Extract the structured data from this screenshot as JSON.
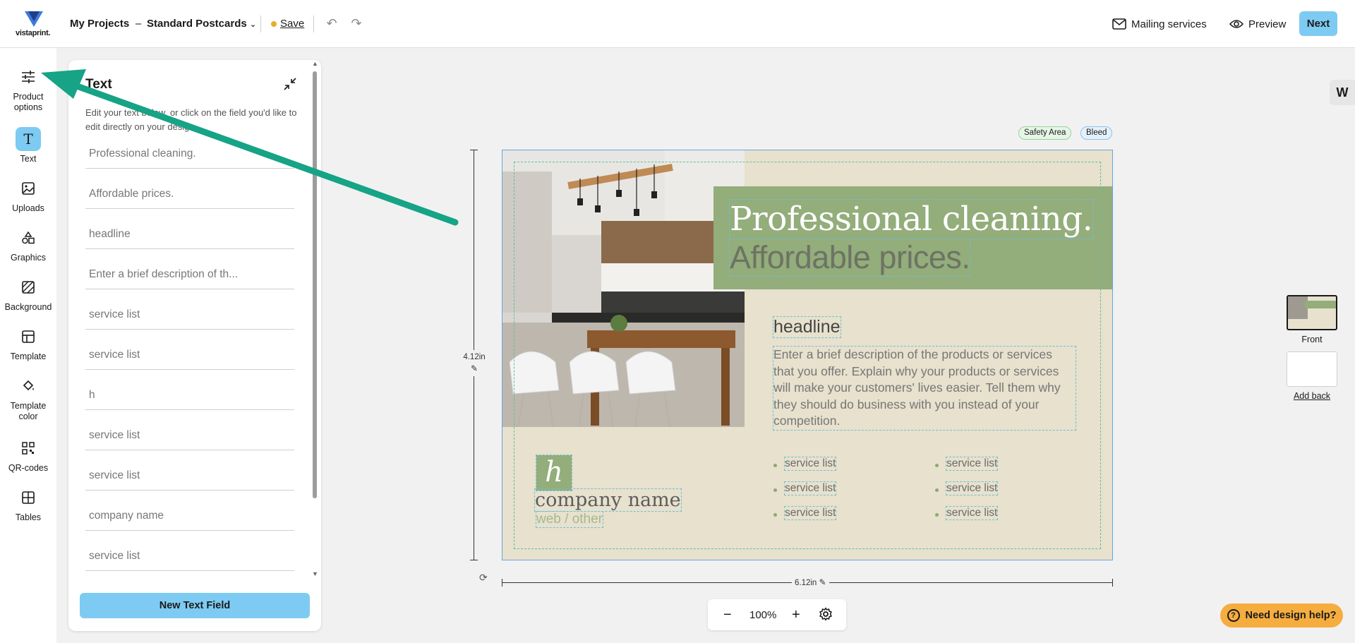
{
  "brand": {
    "logo_text": "vistaprint."
  },
  "header": {
    "crumb_projects": "My Projects",
    "crumb_sep": "–",
    "crumb_product": "Standard Postcards",
    "save_label": "Save",
    "mailing_label": "Mailing services",
    "preview_label": "Preview",
    "next_label": "Next"
  },
  "rail": {
    "items": [
      {
        "label": "Product options",
        "icon": "sliders-icon"
      },
      {
        "label": "Text",
        "icon": "text-icon"
      },
      {
        "label": "Uploads",
        "icon": "image-icon"
      },
      {
        "label": "Graphics",
        "icon": "shapes-icon"
      },
      {
        "label": "Background",
        "icon": "hatch-icon"
      },
      {
        "label": "Template",
        "icon": "template-icon"
      },
      {
        "label": "Template color",
        "icon": "paint-bucket-icon"
      },
      {
        "label": "QR-codes",
        "icon": "qr-icon"
      },
      {
        "label": "Tables",
        "icon": "table-icon"
      }
    ]
  },
  "panel": {
    "title": "Text",
    "description": "Edit your text below, or click on the field you'd like to edit directly on your design.",
    "fields": [
      "Professional cleaning.",
      "Affordable prices.",
      "headline",
      "Enter a brief description of th...",
      "service list",
      "service list",
      "h",
      "service list",
      "service list",
      "company name",
      "service list"
    ],
    "new_field_label": "New Text Field"
  },
  "canvas": {
    "badge_safety": "Safety Area",
    "badge_bleed": "Bleed",
    "height_label": "4.12in",
    "width_label": "6.12in",
    "zoom": "100%",
    "design": {
      "title_line1": "Professional cleaning.",
      "title_line2": "Affordable prices.",
      "headline": "headline",
      "description": "Enter a brief description of the products or services that you offer. Explain why your products or services will make your customers' lives easier. Tell them why they should do business with you instead of your competition.",
      "services_left": [
        "service list",
        "service list",
        "service list"
      ],
      "services_right": [
        "service list",
        "service list",
        "service list"
      ],
      "logo_letter": "h",
      "company_name": "company name",
      "web": "web / other"
    }
  },
  "sides": {
    "front_label": "Front",
    "add_back_label": "Add back"
  },
  "help": {
    "label": "Need design help?"
  },
  "colors": {
    "accent": "#7dcbf2",
    "card_bg": "#e7e1cd",
    "card_green": "#93ad7b",
    "help": "#f6ad3f",
    "arrow": "#16a386"
  }
}
